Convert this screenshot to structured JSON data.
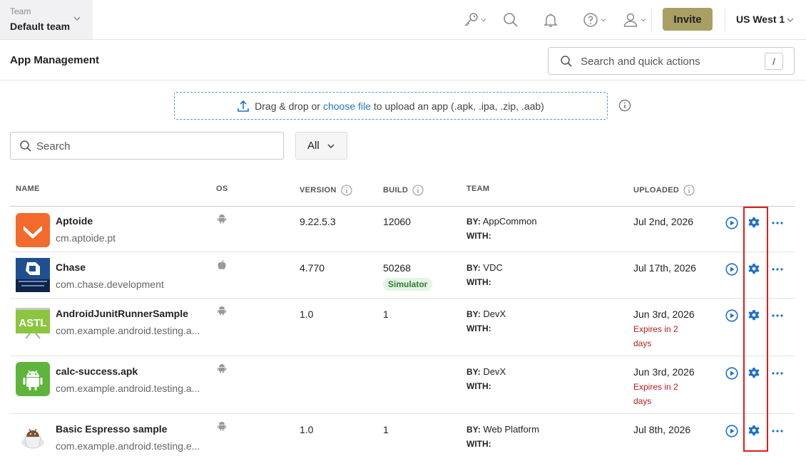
{
  "topbar": {
    "team_label": "Team",
    "team_value": "Default team",
    "invite_label": "Invite",
    "region": "US West 1"
  },
  "header": {
    "title": "App Management",
    "quick_search_placeholder": "Search and quick actions",
    "quick_search_shortcut": "/"
  },
  "upload": {
    "text_before": "Drag & drop or",
    "link": "choose file",
    "text_after": "to upload an app (.apk, .ipa, .zip, .aab)"
  },
  "filters": {
    "search_placeholder": "Search",
    "os_filter": "All"
  },
  "table": {
    "columns": {
      "name": "NAME",
      "os": "OS",
      "version": "VERSION",
      "build": "BUILD",
      "team": "TEAM",
      "uploaded": "UPLOADED"
    },
    "by_label": "BY:",
    "with_label": "WITH:",
    "rows": [
      {
        "name": "Aptoide",
        "package": "cm.aptoide.pt",
        "os": "android",
        "version": "9.22.5.3",
        "build": "12060",
        "build_badge": "",
        "by": "AppCommon",
        "uploaded": "Jul 2nd, 2026",
        "expires_line1": "",
        "expires_line2": "",
        "logo": "aptoide-logo"
      },
      {
        "name": "Chase",
        "package": "com.chase.development",
        "os": "ios",
        "version": "4.770",
        "build": "50268",
        "build_badge": "Simulator",
        "by": "VDC",
        "uploaded": "Jul 17th, 2026",
        "expires_line1": "",
        "expires_line2": "",
        "logo": "chase-logo"
      },
      {
        "name": "AndroidJunitRunnerSample",
        "package": "com.example.android.testing.a...",
        "os": "android",
        "version": "1.0",
        "build": "1",
        "build_badge": "",
        "by": "DevX",
        "uploaded": "Jun 3rd, 2026",
        "expires_line1": "Expires in 2",
        "expires_line2": "days",
        "logo": "astl-logo",
        "logo_text": "ASTL"
      },
      {
        "name": "calc-success.apk",
        "package": "com.example.android.testing.a...",
        "os": "android",
        "version": "",
        "build": "",
        "build_badge": "",
        "by": "DevX",
        "uploaded": "Jun 3rd, 2026",
        "expires_line1": "Expires in 2",
        "expires_line2": "days",
        "logo": "android-logo"
      },
      {
        "name": "Basic Espresso sample",
        "package": "com.example.android.testing.e...",
        "os": "android",
        "version": "1.0",
        "build": "1",
        "build_badge": "",
        "by": "Web Platform",
        "uploaded": "Jul 8th, 2026",
        "expires_line1": "",
        "expires_line2": "",
        "logo": "espresso-logo"
      }
    ]
  },
  "colors": {
    "invite_bg": "#a79f64",
    "link_blue": "#1f75c4",
    "action_blue": "#1d6fd1",
    "expires_red": "#b71c1c",
    "highlight_red": "#e31b1b",
    "simulator_green": "#2e7d32"
  }
}
